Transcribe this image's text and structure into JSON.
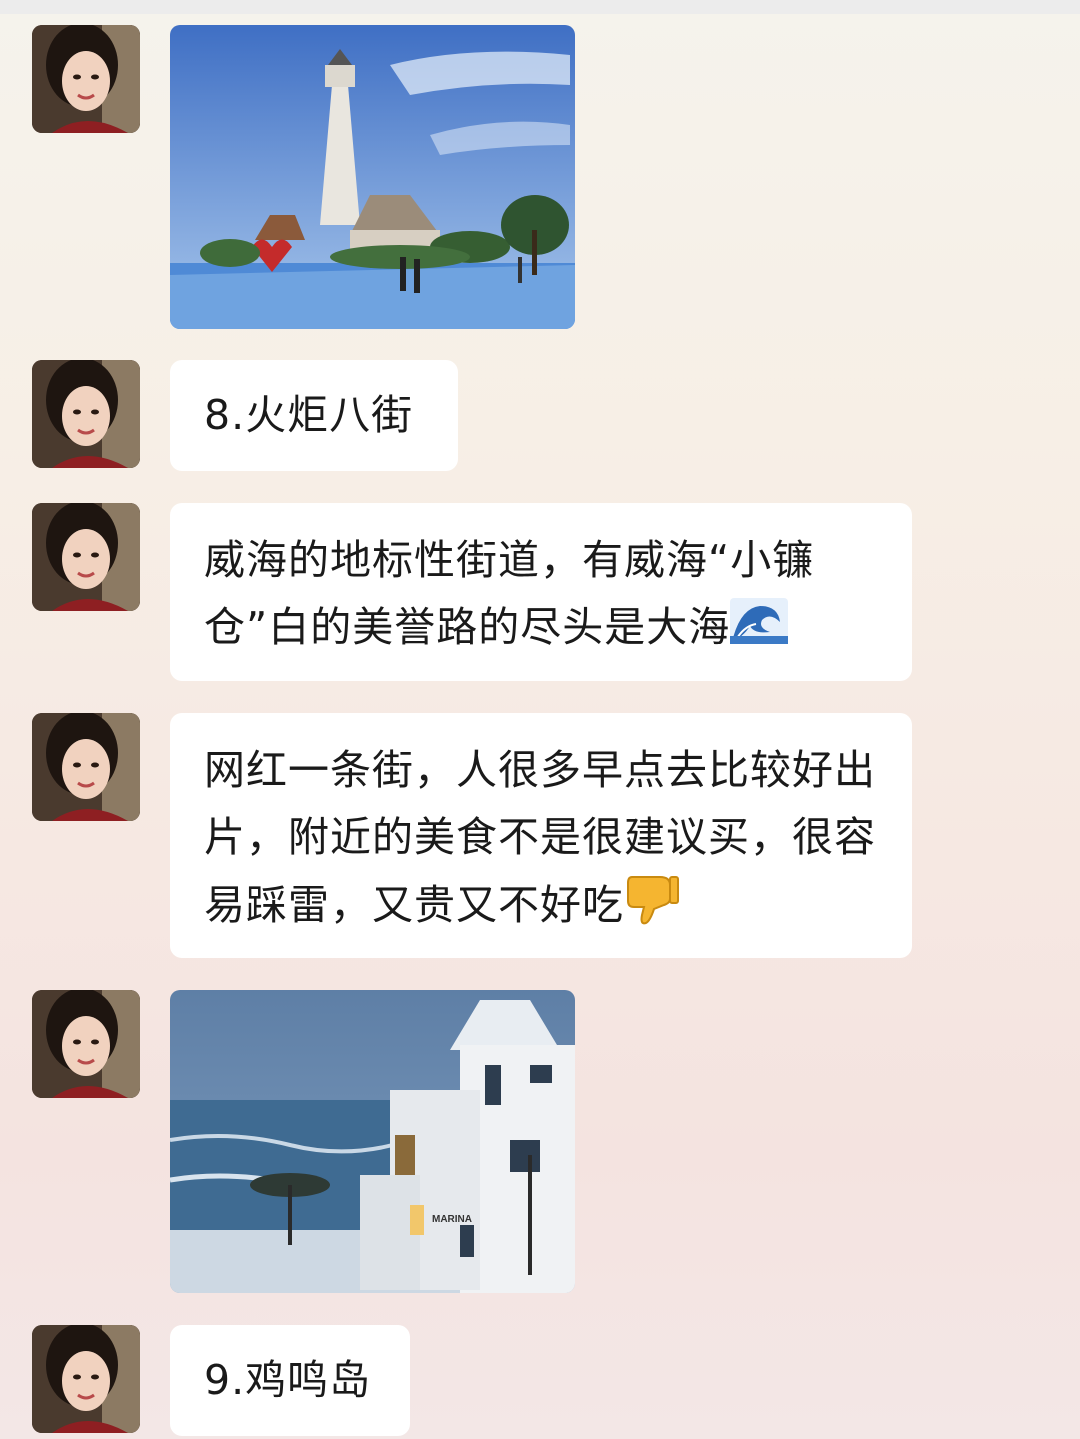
{
  "messages": [
    {
      "type": "image",
      "image_subject": "lighthouse-photo"
    },
    {
      "type": "text",
      "text": "8.火炬八街"
    },
    {
      "type": "text",
      "text": "威海的地标性街道，有威海“小镰仓”白的美誉路的尽头是大海",
      "emoji": "wave-emoji"
    },
    {
      "type": "text",
      "text": "网红一条街，人很多早点去比较好出片，附近的美食不是很建议买，很容易踩雷，又贵又不好吃",
      "emoji": "thumbs-down-emoji"
    },
    {
      "type": "image",
      "image_subject": "seaside-white-house-photo"
    },
    {
      "type": "text",
      "text": "9.鸡鸣岛"
    }
  ],
  "colors": {
    "bubble": "#ffffff",
    "text": "#1a1a1a"
  }
}
